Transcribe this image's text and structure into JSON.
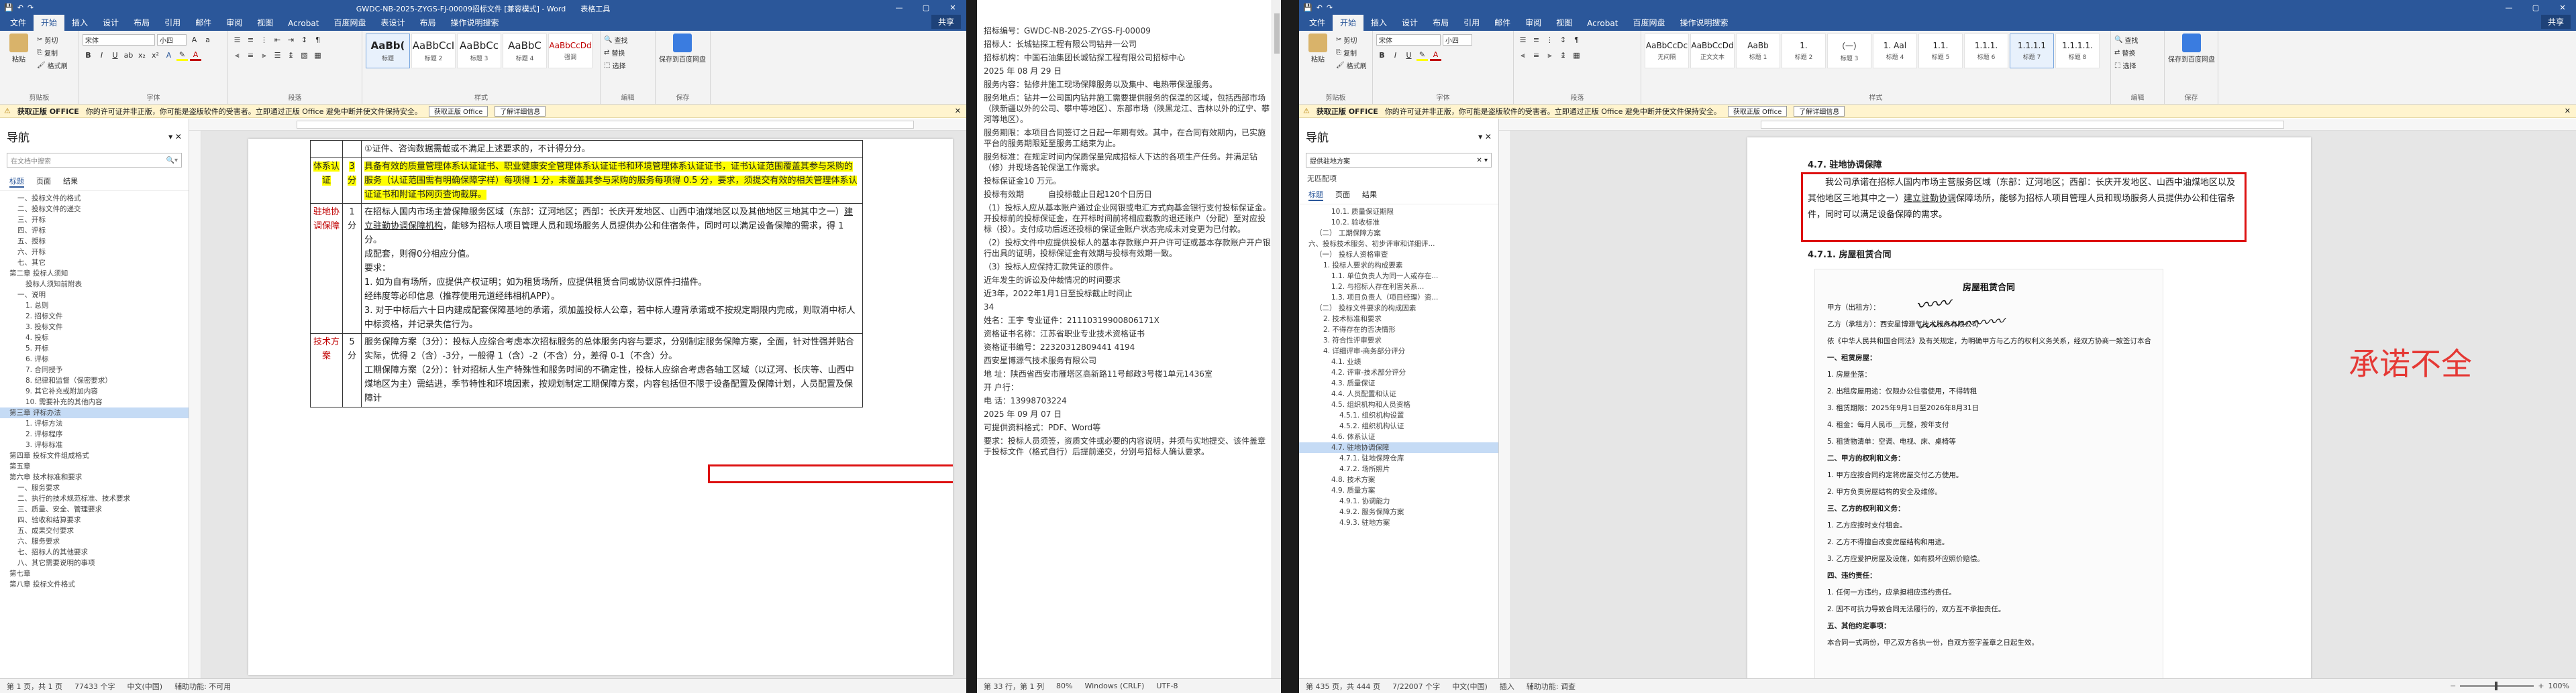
{
  "win1": {
    "title": "GWDC-NB-2025-ZYGS-FJ-00009招标文件 [兼容模式] - Word",
    "context_tab": "表格工具",
    "qat": [
      "保存",
      "撤销",
      "恢复"
    ],
    "window_controls": [
      "—",
      "▢",
      "✕"
    ],
    "tabs": [
      "文件",
      "开始",
      "插入",
      "设计",
      "布局",
      "引用",
      "邮件",
      "审阅",
      "视图",
      "Acrobat",
      "百度网盘",
      "表设计",
      "布局",
      "操作说明搜索"
    ],
    "share": "共享",
    "ribbon": {
      "clipboard": {
        "paste": "粘贴",
        "cut": "剪切",
        "copy": "复制",
        "painter": "格式刷",
        "label": "剪贴板"
      },
      "font": {
        "name": "宋体",
        "size": "小四",
        "label": "字体"
      },
      "paragraph": {
        "label": "段落"
      },
      "styles": [
        {
          "preview": "AaBb(",
          "name": "标题"
        },
        {
          "preview": "AaBbCcI",
          "name": "标题 2"
        },
        {
          "preview": "AaBbCc",
          "name": "标题 3"
        },
        {
          "preview": "AaBbC",
          "name": "标题 4"
        },
        {
          "preview": "AaBbCcDd",
          "name": "强调"
        }
      ],
      "styles_label": "样式",
      "editing": {
        "find": "查找",
        "replace": "替换",
        "select": "选择",
        "label": "编辑"
      },
      "save": {
        "label": "保存到百度网盘",
        "group": "保存"
      }
    },
    "message": {
      "title": "获取正版 OFFICE",
      "text": "你的许可证并非正版，你可能是盗版软件的受害者。立即通过正版 Office 避免中断并使文件保持安全。",
      "btn1": "获取正版 Office",
      "btn2": "了解详细信息"
    },
    "nav": {
      "title": "导航",
      "search_placeholder": "在文档中搜索",
      "tabs": [
        "标题",
        "页面",
        "结果"
      ],
      "items": [
        "一、投标文件的格式",
        "二、投标文件的递交",
        "三、开标",
        "四、评标",
        "五、授标",
        "六、开标",
        "七、其它",
        "第二章  投标人须知",
        "投标人须知前附表",
        "一、说明",
        "1. 总则",
        "2. 招标文件",
        "3. 投标文件",
        "4. 投标",
        "5. 开标",
        "6. 评标",
        "7. 合同授予",
        "8. 纪律和监督（保密要求）",
        "9. 其它补充或附加内容",
        "10. 需要补充的其他内容",
        "第三章  评标办法",
        "1. 评标方法",
        "2. 评标程序",
        "3. 评标标准",
        "第四章  投标文件组成格式",
        "第五章",
        "第六章  技术标准和要求",
        "一、服务要求",
        "二、执行的技术规范标准、技术要求",
        "三、质量、安全、管理要求",
        "四、验收和结算要求",
        "五、成果交付要求",
        "六、服务要求",
        "七、招标人的其他要求",
        "八、其它需要说明的事项",
        "第七章",
        "第八章  投标文件格式"
      ],
      "selected_index": 20
    },
    "table": {
      "row0": "①证件、咨询数据需截或不满足上述要求的，不计得分分。",
      "label_quality": "体系认证",
      "score_quality": "3分",
      "quality_text": "具备有效的质量管理体系认证证书、职业健康安全管理体系认证证书和环境管理体系认证证书，证书认证范围覆盖其参与采购的服务（认证范围需有明确保障字样）每项得 1 分，未覆盖其参与采购的服务每项得 0.5 分，要求，须提交有效的相关管理体系认证证书和附证书网页查询截屏。",
      "label_network": "驻地协调保障",
      "score_network": "1分",
      "network_text_1": "在招标人国内市场主营保障服务区域（东部：辽河地区；西部：长庆开发地区、山西中油煤地区以及其他地区三地其中之一）",
      "network_link": "建立驻勤协调保障机构",
      "network_text_2": "，能够为招标人项目管理人员和现场服务人员提供办公和住宿条件，同时可以满足设备保障的需求，得 1 分。",
      "network_text_3": "成配套，则得0分相应分值。",
      "network_text_4": "要求：",
      "network_text_5": "1. 如为自有场所，应提供产权证明；如为租赁场所，应提供租赁合同或协议原件扫描件。",
      "network_text_6": "经纬度等必印信息（推荐使用元道经纬相机APP）。",
      "network_text_7": "3. 对于中标后六十日内建成配套保障基地的承诺，须加盖投标人公章，若中标人遵背承诺或不按规定期限内完成，则取消中标人中标资格，并记录失信行为。",
      "label_tech": "技术方案",
      "score_tech": "5分",
      "tech_text_1": "服务保障方案（3分）：投标人应综合考虑本次招标服务的总体服务内容与要求，分别制定服务保障方案，全面，针对性强并贴合实际，优得 2（含）-3分，一般得 1（含）-2（不含）分，差得 0-1（不含）分。",
      "tech_text_2": "工期保障方案（2分）：针对招标人生产特殊性和服务时间的不确定性，投标人应综合考虑各轴工区域（以辽河、长庆等、山西中煤地区为主）需结进，季节特性和环境因素，按规划制定工期保障方案，内容包括但不限于设备配置及保障计划，人员配置及保障计"
    },
    "status": {
      "page": "第 1 页，共 1 页",
      "words": "77433 个字",
      "lang": "中文(中国)",
      "mode": "辅助功能: 不可用"
    }
  },
  "win2": {
    "lines": [
      "招标编号：GWDC-NB-2025-ZYGS-FJ-00009",
      "招标人：长城钻探工程有限公司钻井一公司",
      "招标机构：中国石油集团长城钻探工程有限公司招标中心",
      "2025 年 08 月 29 日",
      "服务内容：钻修井施工现场保障服务以及集中、电热带保温服务。",
      "服务地点：钻井一公司国内钻井施工需要提供服务的保温的区域，包括西部市场（陕新疆以外的公司、攀中等地区）、东部市场（陕黑龙江、吉林以外的辽宁、攀河等地区）。",
      "服务期限：本项目合同签订之日起一年期有效。其中，在合同有效期内，已实施平台的服务期限延至服务工结束为止。",
      "服务标准：在规定时间内保质保量完成招标人下达的各项生产任务。并满足钻（修）井现场各轮保温工作需求。",
      "投标保证金10 万元。",
      "投标有效期　　　自投标截止日起120个日历日",
      "（1）投标人应从基本账户通过企业网银或电汇方式向基金银行支付投标保证金。开投标前的投标保证金，在开标时间前将相应截教的退还账户（分配）至对应投标（投）。支付成功后返还投标的保证金账户状态完成未对变更为已付款。",
      "（2）投标文件中应提供投标人的基本存款账户开户许可证或基本存款账户开户银行出具的证明，投标保证金有效期与投标有效期一致。",
      "（3）投标人应保持汇款凭证的原件。",
      "近年发生的诉讼及仲裁情况的时间要求",
      "近3年，2022年1月1日至投标截止时间止",
      "34",
      "姓名：王宇 专业证件：21110319900806171X",
      "资格证书名称：江苏省职业专业技术资格证书",
      "资格证书编号：22320312809441 4194",
      "西安星博源气技术服务有限公司",
      "地  址：陕西省西安市雁塔区高新路11号邮政3号楼1单元1436室",
      "开   户行：",
      "电  话：13998703224",
      "2025 年 09 月 07 日",
      "可提供资料格式：PDF、Word等",
      "要求：投标人员须签，资质文件或必要的内容说明，并须与实地提交、该件盖章于投标文件（格式自行）后提前递交，分别与招标人确认要求。"
    ],
    "status": {
      "page": "第 33 行，第 1 列",
      "chars": "80%",
      "encoding": "Windows (CRLF)",
      "charset": "UTF-8"
    }
  },
  "win3": {
    "tabs": [
      "文件",
      "开始",
      "插入",
      "设计",
      "布局",
      "引用",
      "邮件",
      "审阅",
      "视图",
      "Acrobat",
      "百度网盘",
      "操作说明搜索"
    ],
    "share": "共享",
    "styles": [
      {
        "preview": "AaBbCcDc",
        "name": "无间隔"
      },
      {
        "preview": "AaBbCcDd",
        "name": "正文文本"
      },
      {
        "preview": "AaBb",
        "name": "标题 1"
      },
      {
        "preview": "1.",
        "name": "标题 2"
      },
      {
        "preview": "（一）",
        "name": "标题 3"
      },
      {
        "preview": "1. Aal",
        "name": "标题 4"
      },
      {
        "preview": "1.1.",
        "name": "标题 5"
      },
      {
        "preview": "1.1.1.",
        "name": "标题 6"
      },
      {
        "preview": "1.1.1.1",
        "name": "标题 7"
      },
      {
        "preview": "1.1.1.1.",
        "name": "标题 8"
      }
    ],
    "nav": {
      "title": "导航",
      "search_value": "提供驻地方案",
      "no_match": "无匹配项",
      "tabs": [
        "标题",
        "页面",
        "结果"
      ],
      "items": [
        "10.1. 质量保证期限",
        "10.2. 验收标准",
        "（二） 工期保障方案",
        "六、投标技术服务、初步评审和详细评...",
        "（一） 投标人资格审查",
        "1. 投标人要求的构成要素",
        "1.1. 单位负责人为同一人或存在...",
        "1.2. 与招标人存在利害关系...",
        "1.3. 项目负责人（项目经理）资...",
        "（二） 投标文件要求的构成因素",
        "2. 技术标准和要求",
        "2. 不得存在的否决情形",
        "3. 符合性评审要求",
        "4. 详细评审-商务部分评分",
        "4.1. 业绩",
        "4.2. 评审-技术部分评分",
        "4.3. 质量保证",
        "4.4. 人员配置和认证",
        "4.5. 组织机构和人员资格",
        "4.5.1. 组织机构设置",
        "4.5.2. 组织机构认证",
        "4.6. 体系认证",
        "4.7. 驻地协调保障",
        "4.7.1. 驻地保障仓库",
        "4.7.2. 场所照片",
        "4.8. 技术方案",
        "4.9. 质量方案",
        "4.9.1. 协调能力",
        "4.9.2. 服务保障方案",
        "4.9.3. 驻地方案"
      ],
      "selected_index": 22
    },
    "doc": {
      "heading_47": "4.7. 驻地协调保障",
      "para": "我公司承诺在招标人国内市场主营服务区域（东部：辽河地区；西部：长庆开发地区、山西中油煤地区以及其他地区三地其中之一）",
      "para_link": "建立驻勤协调",
      "para_2": "保障场所，能够为招标人项目管理人员和现场服务人员提供办公和住宿条件，同时可以满足设备保障的需求。",
      "heading_471": "4.7.1. 房屋租赁合同",
      "contract_title": "房屋租赁合同",
      "contract_lines": [
        "甲方（出租方）：",
        "乙方（承租方）：西安星博源气技术服务有限公司",
        "依《中华人民共和国合同法》及有关规定，为明确甲方与乙方的权利义务关系，经双方协商一致签订本合同。",
        "一、租赁房屋：",
        "1. 房屋坐落：",
        "2. 出租房屋用途：仅限办公住宿使用，不得转租",
        "3. 租赁期限：2025年9月1日至2026年8月31日",
        "4. 租金：每月人民币＿元整，按年支付",
        "5. 租赁物清单：空调、电视、床、桌椅等",
        "二、甲方的权利和义务：",
        "1. 甲方应按合同约定将房屋交付乙方使用。",
        "2. 甲方负责房屋结构的安全及维修。",
        "三、乙方的权利和义务：",
        "1. 乙方应按时支付租金。",
        "2. 乙方不得擅自改变房屋结构和用途。",
        "3. 乙方应爱护房屋及设施，如有损坏应照价赔偿。",
        "四、违约责任：",
        "1. 任何一方违约，应承担相应违约责任。",
        "2. 因不可抗力导致合同无法履行的，双方互不承担责任。",
        "五、其他约定事项：",
        "本合同一式两份，甲乙双方各执一份，自双方签字盖章之日起生效。"
      ],
      "annotation": "承诺不全"
    },
    "status": {
      "page": "第 435 页，共 444 页",
      "words": "7/22007 个字",
      "lang": "中文(中国)",
      "insert": "插入",
      "access": "辅助功能: 调查",
      "zoom": "100%"
    }
  },
  "colors": {
    "word_blue": "#2b579a",
    "highlight": "#ffff00",
    "annotation_red": "#e53935",
    "box_red": "#d11111"
  }
}
